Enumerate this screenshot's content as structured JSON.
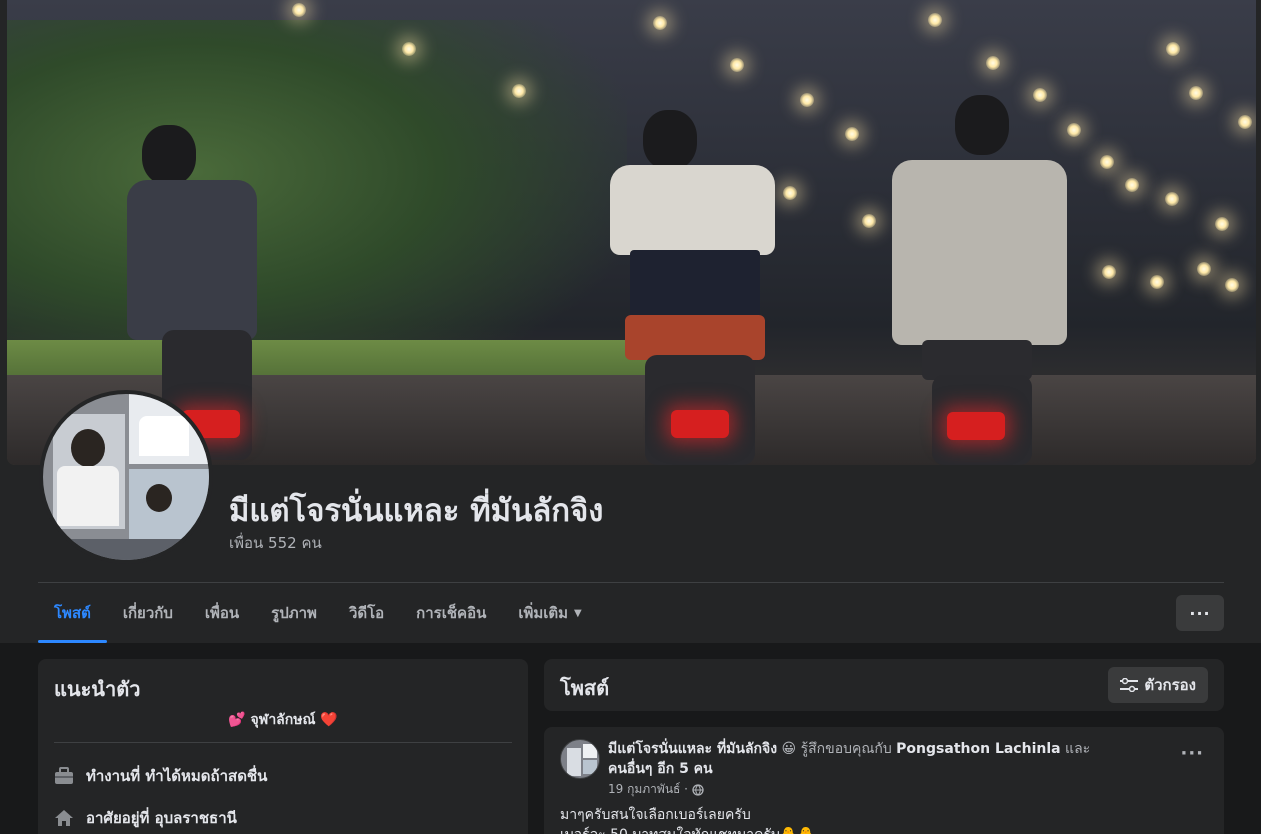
{
  "profile": {
    "name": "มีแต่โจรนั่นแหละ ที่มันลักจิง",
    "friends": "เพื่อน 552 คน"
  },
  "tabs": [
    {
      "label": "โพสต์"
    },
    {
      "label": "เกี่ยวกับ"
    },
    {
      "label": "เพื่อน"
    },
    {
      "label": "รูปภาพ"
    },
    {
      "label": "วิดีโอ"
    },
    {
      "label": "การเช็คอิน"
    },
    {
      "label": "เพิ่มเติม"
    }
  ],
  "more_button": "···",
  "intro": {
    "title": "แนะนำตัว",
    "bio": "💕 จุฬาลักษณ์ ❤️",
    "work": "ทำงานที่ ทำได้หมดถ้าสดชื่น",
    "lives": "อาศัยอยู่ที่ อุบลราชธานี"
  },
  "posts": {
    "title": "โพสต์",
    "filter_label": "ตัวกรอง"
  },
  "post": {
    "author": "มีแต่โจรนั่นแหละ ที่มันลักจิง",
    "emoji": "😀",
    "feeling": "รู้สึกขอบคุณกับ",
    "tagged": "Pongsathon Lachinla",
    "and": "และ",
    "others": "คนอื่นๆ อีก 5 คน",
    "date": "19 กุมภาพันธ์ ·",
    "line1": "มาๆครับสนใจเลือกเบอร์เลยครับ",
    "line2": "เบอร์ละ 50 บาทสนใจทักแชทมาครับ🐥🐥"
  },
  "colors": {
    "accent": "#2d88ff",
    "background": "#18191a",
    "card": "#242526"
  }
}
